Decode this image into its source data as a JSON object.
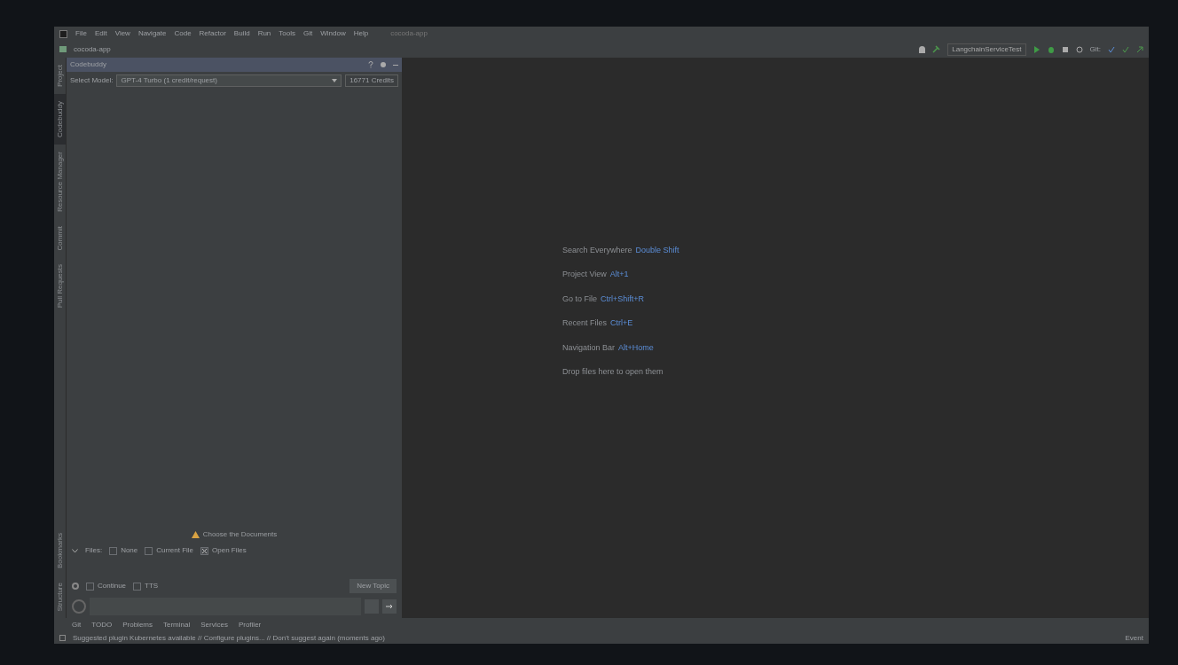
{
  "menu": [
    "File",
    "Edit",
    "View",
    "Navigate",
    "Code",
    "Refactor",
    "Build",
    "Run",
    "Tools",
    "Git",
    "Window",
    "Help"
  ],
  "window": {
    "title": "cocoda-app"
  },
  "nav": {
    "project": "cocoda-app",
    "run_config": "LangchainServiceTest",
    "git_label": "Git:"
  },
  "side_tabs": [
    {
      "label": "Project",
      "selected": false
    },
    {
      "label": "Codebuddy",
      "selected": true
    },
    {
      "label": "Resource Manager",
      "selected": false
    },
    {
      "label": "Commit",
      "selected": false
    },
    {
      "label": "Pull Requests",
      "selected": false
    }
  ],
  "side_tabs_bottom": [
    {
      "label": "Bookmarks",
      "selected": false
    },
    {
      "label": "Structure",
      "selected": false
    }
  ],
  "panel": {
    "title": "Codebuddy",
    "model_label": "Select Model:",
    "model": "GPT-4 Turbo (1 credit/request)",
    "credits": "16771 Credits",
    "warning": "Choose the Documents",
    "context_label": "Files:",
    "context": [
      {
        "label": "None",
        "checked": false
      },
      {
        "label": "Current File",
        "checked": false
      },
      {
        "label": "Open Files",
        "checked": true
      }
    ],
    "options": [
      {
        "label": "Continue",
        "checked": false
      },
      {
        "label": "TTS",
        "checked": false
      }
    ],
    "new_topic": "New Topic"
  },
  "hints": [
    {
      "label": "Search Everywhere",
      "shortcut": "Double Shift"
    },
    {
      "label": "Project View",
      "shortcut": "Alt+1"
    },
    {
      "label": "Go to File",
      "shortcut": "Ctrl+Shift+R"
    },
    {
      "label": "Recent Files",
      "shortcut": "Ctrl+E"
    },
    {
      "label": "Navigation Bar",
      "shortcut": "Alt+Home"
    },
    {
      "label": "Drop files here to open them"
    }
  ],
  "bottom_tools": [
    "Git",
    "TODO",
    "Problems",
    "Terminal",
    "Services",
    "Profiler"
  ],
  "status": {
    "message": "Suggested plugin Kubernetes available // Configure plugins... // Don't suggest again (moments ago)",
    "right": "Event"
  }
}
